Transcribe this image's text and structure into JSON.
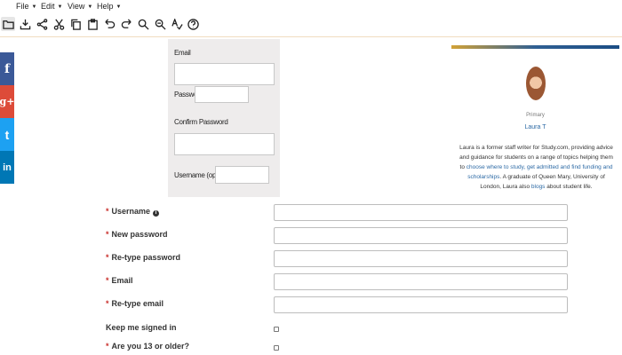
{
  "menubar": {
    "items": [
      {
        "label": "File"
      },
      {
        "label": "Edit"
      },
      {
        "label": "View"
      },
      {
        "label": "Help"
      }
    ]
  },
  "toolbar": {
    "buttons": [
      {
        "icon": "folder-icon"
      },
      {
        "icon": "download-icon"
      },
      {
        "icon": "share-icon"
      },
      {
        "icon": "scissors-icon"
      },
      {
        "icon": "copy-icon"
      },
      {
        "icon": "clipboard-icon"
      },
      {
        "icon": "undo-icon"
      },
      {
        "icon": "redo-icon"
      },
      {
        "icon": "zoom-in-icon"
      },
      {
        "icon": "zoom-out-icon"
      },
      {
        "icon": "spellcheck-icon"
      },
      {
        "icon": "help-icon"
      }
    ]
  },
  "social": {
    "facebook": {
      "glyph": "f",
      "color": "#3b5998"
    },
    "google_plus": {
      "glyph": "g+",
      "color": "#dd4b39"
    },
    "twitter": {
      "glyph": "t",
      "color": "#1da1f2"
    },
    "linkedin": {
      "glyph": "in",
      "color": "#0077b5"
    }
  },
  "form_panel": {
    "email_label": "Email",
    "password_label": "Password",
    "confirm_label": "Confirm Password",
    "username_label": "Username (optional)"
  },
  "profile_card": {
    "role": "Primary",
    "name": "Laura T",
    "bio_line1": "Laura is a former staff writer for Study.com, providing advice and guidance for",
    "bio_line2": "students on a range of topics helping them to ",
    "bio_link1": "choose where to study, get admitted and",
    "bio_line3_link": "find funding and scholarships",
    "bio_line3": ". A graduate of Queen Mary, University of London, Laura also",
    "bio_line4_link": "blogs",
    "bio_line4": " about student life."
  },
  "registration": {
    "username_label": "Username",
    "new_password_label": "New password",
    "retype_password_label": "Re-type password",
    "email_label": "Email",
    "retype_email_label": "Re-type email",
    "keep_signed_in_label": "Keep me signed in",
    "age_label": "Are you 13 or older?",
    "required_marker": "*",
    "info_glyph": "i"
  },
  "colors": {
    "required": "#c9302c",
    "link": "#2d6aa5"
  }
}
